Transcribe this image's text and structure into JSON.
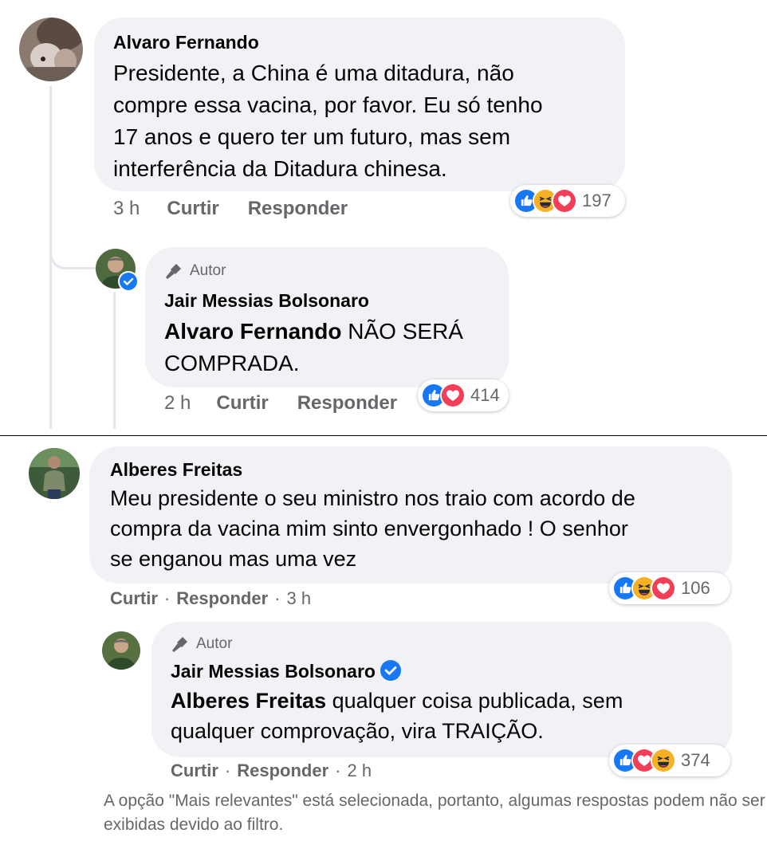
{
  "colors": {
    "bubble": "#f0f2f5",
    "meta_text": "#65676b",
    "like_blue": "#1877f2",
    "love_red": "#f33e58",
    "haha_yellow": "#f7b125"
  },
  "thread1": {
    "comment": {
      "avatar_icon": "user-photo-avatar",
      "author": "Alvaro Fernando",
      "text_lines": [
        "Presidente, a China é uma ditadura, não",
        "compre essa vacina, por favor. Eu só tenho",
        "17 anos e quero ter um futuro, mas sem",
        "interferência da Ditadura chinesa."
      ],
      "time": "3 h",
      "like_label": "Curtir",
      "reply_label": "Responder",
      "reactions": [
        "like-icon",
        "haha-icon",
        "love-icon"
      ],
      "reaction_count": "197"
    },
    "reply": {
      "avatar_icon": "user-photo-avatar",
      "badge_icon": "verified-badge-icon",
      "author_tag": "Autor",
      "author": "Jair Messias Bolsonaro",
      "mention": "Alvaro Fernando",
      "text_line1_rest": " NÃO SERÁ",
      "text_line2": "COMPRADA.",
      "time": "2 h",
      "like_label": "Curtir",
      "reply_label": "Responder",
      "reactions": [
        "like-icon",
        "love-icon"
      ],
      "reaction_count": "414"
    }
  },
  "thread2": {
    "comment": {
      "avatar_icon": "user-photo-avatar",
      "author": "Alberes Freitas",
      "text_lines": [
        "Meu presidente o seu ministro nos traio com acordo de",
        "compra da vacina mim sinto envergonhado ! O senhor",
        "se enganou mas uma vez"
      ],
      "like_label": "Curtir",
      "reply_label": "Responder",
      "time": "3 h",
      "separator": "·",
      "reactions": [
        "like-icon",
        "haha-icon",
        "love-icon"
      ],
      "reaction_count": "106"
    },
    "reply": {
      "avatar_icon": "user-photo-avatar",
      "author_tag": "Autor",
      "author": "Jair Messias Bolsonaro",
      "verified_icon": "verified-badge-icon",
      "mention": "Alberes Freitas",
      "text_line1_rest": " qualquer coisa publicada, sem",
      "text_line2": "qualquer comprovação, vira TRAIÇÃO.",
      "like_label": "Curtir",
      "reply_label": "Responder",
      "time": "2 h",
      "separator": "·",
      "reactions": [
        "like-icon",
        "love-icon",
        "haha-icon"
      ],
      "reaction_count": "374"
    }
  },
  "footer_text": "A opção \"Mais relevantes\" está selecionada, portanto, algumas respostas podem não ser exibidas devido ao filtro."
}
